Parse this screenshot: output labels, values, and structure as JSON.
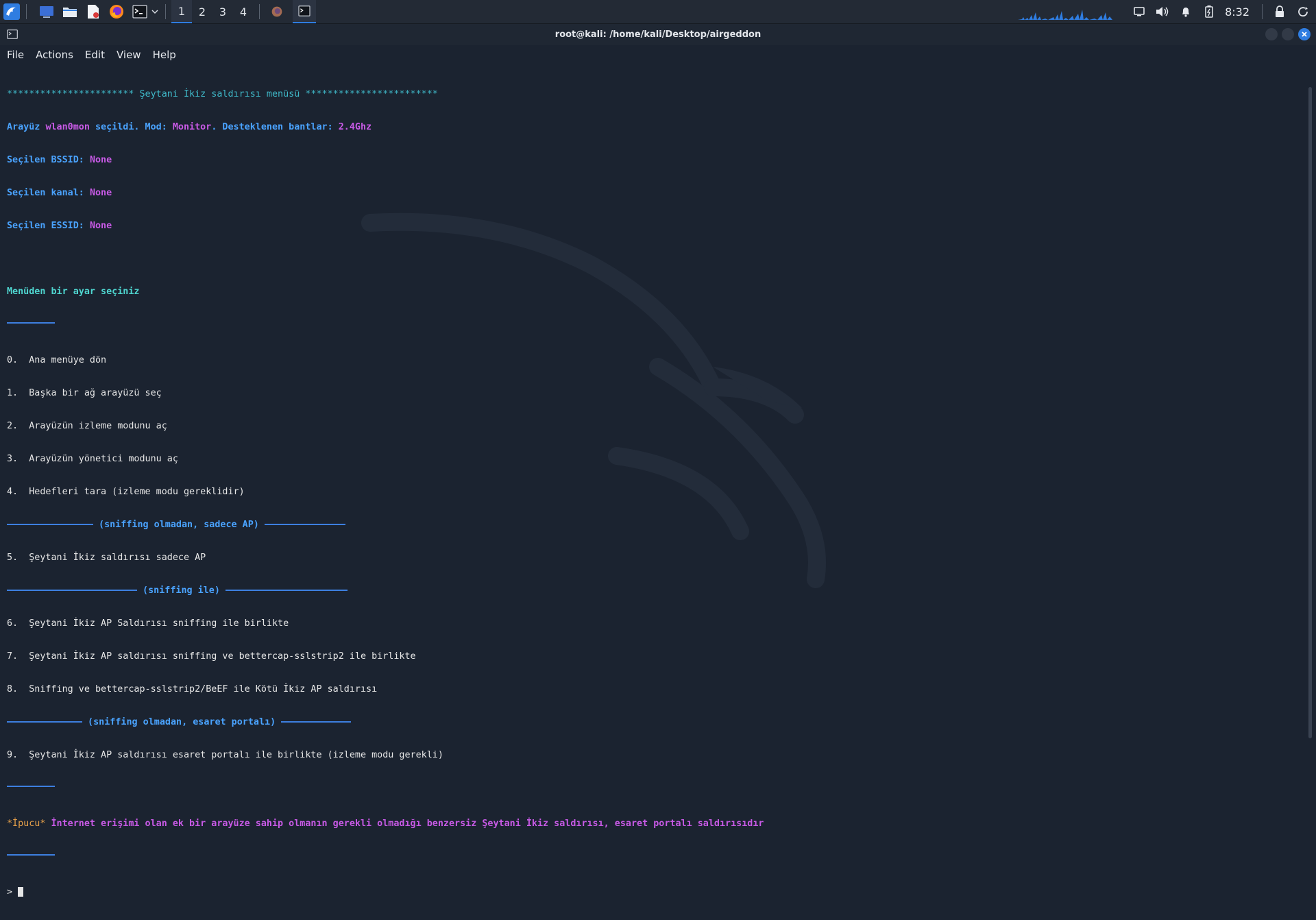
{
  "taskbar": {
    "workspaces": [
      "1",
      "2",
      "3",
      "4"
    ],
    "active_workspace": 0,
    "clock": "8:32",
    "icons": [
      "kali-menu-icon",
      "desktop-icon",
      "file-manager-icon",
      "text-editor-icon",
      "firefox-icon",
      "terminal-icon",
      "dropdown-icon"
    ]
  },
  "window": {
    "title": "root@kali: /home/kali/Desktop/airgeddon"
  },
  "menubar": {
    "items": [
      "File",
      "Actions",
      "Edit",
      "View",
      "Help"
    ]
  },
  "terminal": {
    "header_left": "***********************",
    "header_title": " Şeytani İkiz saldırısı menüsü ",
    "header_right": "************************",
    "iface_label": "Arayüz ",
    "iface_value": "wlan0mon",
    "iface_selected": " seçildi.",
    "mode_label": " Mod: ",
    "mode_value": "Monitor",
    "bands_label": ". Desteklenen bantlar: ",
    "bands_value": "2.4Ghz",
    "bssid_label": "Seçilen BSSID: ",
    "bssid_value": "None",
    "channel_label": "Seçilen kanal: ",
    "channel_value": "None",
    "essid_label": "Seçilen ESSID: ",
    "essid_value": "None",
    "menu_prompt": "Menüden bir ayar seçiniz",
    "options_a": [
      "0.  Ana menüye dön",
      "1.  Başka bir ağ arayüzü seç",
      "2.  Arayüzün izleme modunu aç",
      "3.  Arayüzün yönetici modunu aç",
      "4.  Hedefleri tara (izleme modu gereklidir)"
    ],
    "section_1": " (sniffing olmadan, sadece AP) ",
    "option_5": "5.  Şeytani İkiz saldırısı sadece AP",
    "section_2": " (sniffing ile) ",
    "option_6": "6.  Şeytani İkiz AP Saldırısı sniffing ile birlikte",
    "option_7": "7.  Şeytani İkiz AP saldırısı sniffing ve bettercap-sslstrip2 ile birlikte",
    "option_8": "8.  Sniffing ve bettercap-sslstrip2/BeEF ile Kötü İkiz AP saldırısı",
    "section_3": " (sniffing olmadan, esaret portalı) ",
    "option_9": "9.  Şeytani İkiz AP saldırısı esaret portalı ile birlikte (izleme modu gerekli)",
    "hint_tag": "*İpucu*",
    "hint_text": " İnternet erişimi olan ek bir arayüze sahip olmanın gerekli olmadığı benzersiz Şeytani İkiz saldırısı, esaret portalı saldırısıdır",
    "prompt": "> "
  },
  "colors": {
    "accent": "#2f7de1",
    "stars": "#3fb8c8",
    "label_blue": "#4aa3ff",
    "value_magenta": "#c85ae6",
    "prompt_cyan": "#4fd6d0",
    "hint_orange": "#e9a24a"
  }
}
